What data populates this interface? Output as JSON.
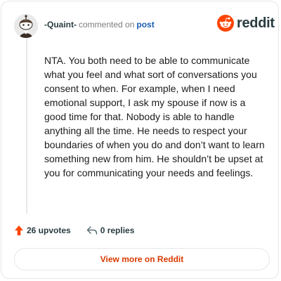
{
  "comment": {
    "username": "-Quaint-",
    "action": "commented on",
    "post_link": "post",
    "body": "NTA. You both need to be able to communicate what you feel and what sort of conversations you consent to when. For example, when I need emotional support, I ask my spouse if now is a good time for that. Nobody is able to handle anything all the time. He needs to respect your boundaries of when you do and don’t want to learn something new from him. He shouldn’t be upset at you for communicating your needs and feelings."
  },
  "brand": {
    "name": "reddit",
    "icon": "reddit-logo-icon"
  },
  "footer": {
    "upvotes_label": "26 upvotes",
    "replies_label": "0 replies",
    "upvote_icon": "upvote-arrow-icon",
    "reply_icon": "reply-arrow-icon"
  },
  "cta": {
    "label": "View more on Reddit"
  },
  "colors": {
    "accent": "#ff4500",
    "link": "#1a5cb0",
    "cta_text": "#d93a00",
    "username": "#2a3c42",
    "muted": "#7c7c7c",
    "border": "#e5e7ea"
  }
}
